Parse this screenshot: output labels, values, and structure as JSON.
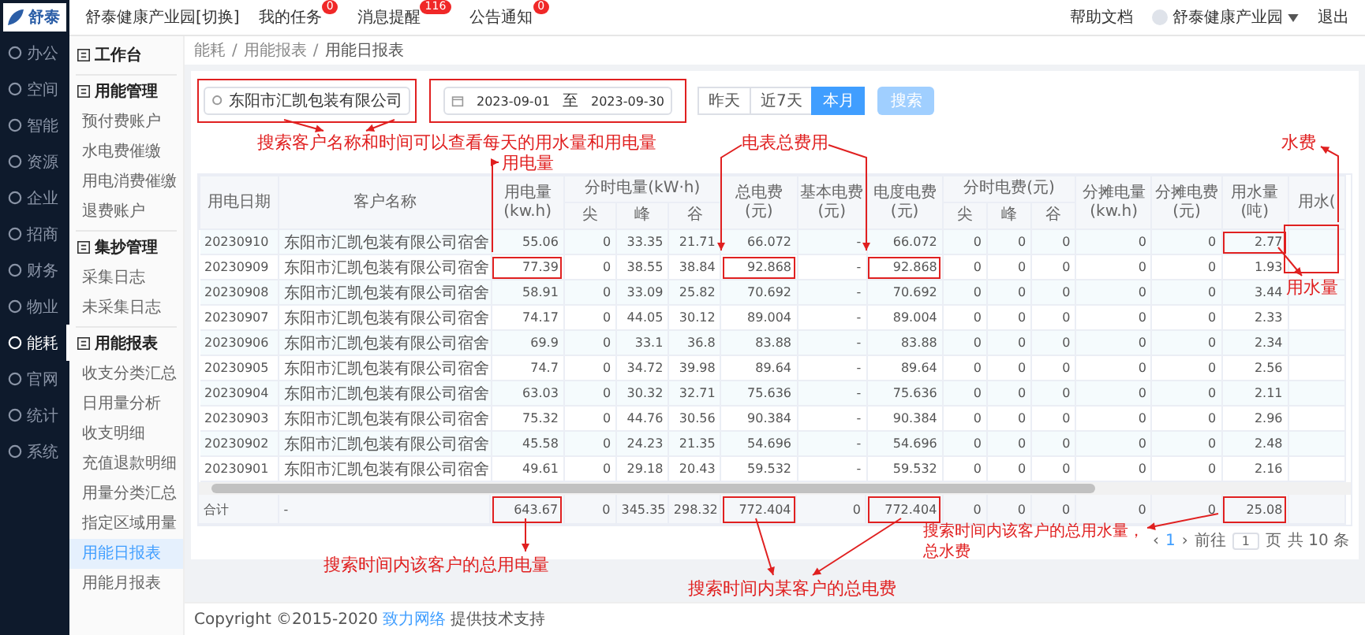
{
  "top_bar": {
    "logo": "舒泰",
    "org": "舒泰健康产业园",
    "switch": "[切换]",
    "links": [
      {
        "label": "我的任务",
        "badge": "0"
      },
      {
        "label": "消息提醒",
        "badge": "116"
      },
      {
        "label": "公告通知",
        "badge": "0"
      }
    ],
    "help": "帮助文档",
    "user": "舒泰健康产业园",
    "logout": "退出"
  },
  "nav": [
    {
      "label": "办公",
      "selected": false
    },
    {
      "label": "空间",
      "selected": false
    },
    {
      "label": "智能",
      "selected": false
    },
    {
      "label": "资源",
      "selected": false
    },
    {
      "label": "企业",
      "selected": false
    },
    {
      "label": "招商",
      "selected": false
    },
    {
      "label": "财务",
      "selected": false
    },
    {
      "label": "物业",
      "selected": false
    },
    {
      "label": "能耗",
      "selected": true
    },
    {
      "label": "官网",
      "selected": false
    },
    {
      "label": "统计",
      "selected": false
    },
    {
      "label": "系统",
      "selected": false
    }
  ],
  "submenu": {
    "workbench": "工作台",
    "groups": [
      {
        "title": "用能管理",
        "items": [
          {
            "label": "预付费账户",
            "selected": false
          },
          {
            "label": "水电费催缴",
            "selected": false
          },
          {
            "label": "用电消费催缴",
            "selected": false
          },
          {
            "label": "退费账户",
            "selected": false
          }
        ]
      },
      {
        "title": "集抄管理",
        "items": [
          {
            "label": "采集日志",
            "selected": false
          },
          {
            "label": "未采集日志",
            "selected": false
          }
        ]
      },
      {
        "title": "用能报表",
        "items": [
          {
            "label": "收支分类汇总",
            "selected": false
          },
          {
            "label": "日用量分析",
            "selected": false
          },
          {
            "label": "收支明细",
            "selected": false
          },
          {
            "label": "充值退款明细",
            "selected": false
          },
          {
            "label": "用量分类汇总",
            "selected": false
          },
          {
            "label": "指定区域用量",
            "selected": false
          },
          {
            "label": "用能日报表",
            "selected": true
          },
          {
            "label": "用能月报表",
            "selected": false
          }
        ]
      }
    ]
  },
  "breadcrumb": [
    "能耗",
    "用能报表",
    "用能日报表"
  ],
  "breadcrumb_separator": "/",
  "filter": {
    "customer": "东阳市汇凯包装有限公司",
    "date_from": "2023-09-01",
    "separator": "至",
    "date_to": "2023-09-30",
    "ranges": [
      {
        "label": "昨天",
        "selected": false
      },
      {
        "label": "近7天",
        "selected": false
      },
      {
        "label": "本月",
        "selected": true
      }
    ],
    "search_button": "搜索"
  },
  "table": {
    "columns": [
      {
        "label": "用电日期"
      },
      {
        "label": "客户名称"
      },
      {
        "label": "用电量(kw.h)"
      },
      {
        "label": "分时电量(kW·h)",
        "colspan": 3,
        "children": [
          {
            "label": "尖"
          },
          {
            "label": "峰"
          },
          {
            "label": "谷"
          }
        ]
      },
      {
        "label": "总电费(元)"
      },
      {
        "label": "基本电费(元)"
      },
      {
        "label": "电度电费(元)"
      },
      {
        "label": "分时电费(元)",
        "colspan": 3,
        "children": [
          {
            "label": "尖"
          },
          {
            "label": "峰"
          },
          {
            "label": "谷"
          }
        ]
      },
      {
        "label": "分摊电量(kw.h)"
      },
      {
        "label": "分摊电费(元)"
      },
      {
        "label": "用水量(吨)"
      }
    ],
    "cut_column_header": "用水(",
    "rows": [
      [
        "20230910",
        "东阳市汇凯包装有限公司宿舍",
        "55.06",
        "0",
        "33.35",
        "21.71",
        "66.072",
        "-",
        "66.072",
        "0",
        "0",
        "0",
        "0",
        "0",
        "2.77"
      ],
      [
        "20230909",
        "东阳市汇凯包装有限公司宿舍",
        "77.39",
        "0",
        "38.55",
        "38.84",
        "92.868",
        "-",
        "92.868",
        "0",
        "0",
        "0",
        "0",
        "0",
        "1.93"
      ],
      [
        "20230908",
        "东阳市汇凯包装有限公司宿舍",
        "58.91",
        "0",
        "33.09",
        "25.82",
        "70.692",
        "-",
        "70.692",
        "0",
        "0",
        "0",
        "0",
        "0",
        "3.44"
      ],
      [
        "20230907",
        "东阳市汇凯包装有限公司宿舍",
        "74.17",
        "0",
        "44.05",
        "30.12",
        "89.004",
        "-",
        "89.004",
        "0",
        "0",
        "0",
        "0",
        "0",
        "2.33"
      ],
      [
        "20230906",
        "东阳市汇凯包装有限公司宿舍",
        "69.9",
        "0",
        "33.1",
        "36.8",
        "83.88",
        "-",
        "83.88",
        "0",
        "0",
        "0",
        "0",
        "0",
        "2.34"
      ],
      [
        "20230905",
        "东阳市汇凯包装有限公司宿舍",
        "74.7",
        "0",
        "34.72",
        "39.98",
        "89.64",
        "-",
        "89.64",
        "0",
        "0",
        "0",
        "0",
        "0",
        "2.56"
      ],
      [
        "20230904",
        "东阳市汇凯包装有限公司宿舍",
        "63.03",
        "0",
        "30.32",
        "32.71",
        "75.636",
        "-",
        "75.636",
        "0",
        "0",
        "0",
        "0",
        "0",
        "2.11"
      ],
      [
        "20230903",
        "东阳市汇凯包装有限公司宿舍",
        "75.32",
        "0",
        "44.76",
        "30.56",
        "90.384",
        "-",
        "90.384",
        "0",
        "0",
        "0",
        "0",
        "0",
        "2.96"
      ],
      [
        "20230902",
        "东阳市汇凯包装有限公司宿舍",
        "45.58",
        "0",
        "24.23",
        "21.35",
        "54.696",
        "-",
        "54.696",
        "0",
        "0",
        "0",
        "0",
        "0",
        "2.48"
      ],
      [
        "20230901",
        "东阳市汇凯包装有限公司宿舍",
        "49.61",
        "0",
        "29.18",
        "20.43",
        "59.532",
        "-",
        "59.532",
        "0",
        "0",
        "0",
        "0",
        "0",
        "2.16"
      ]
    ],
    "total": [
      "合计",
      "-",
      "643.67",
      "0",
      "345.35",
      "298.32",
      "772.404",
      "0",
      "772.404",
      "0",
      "0",
      "0",
      "0",
      "0",
      "25.08"
    ]
  },
  "pagination": {
    "prev": "‹",
    "pages": [
      {
        "label": "1",
        "selected": true
      }
    ],
    "next": "›",
    "goto": "前往",
    "page_input": "1",
    "page_unit": "页",
    "total": "共 10 条"
  },
  "footer": {
    "copyright": "Copyright ©2015-2020",
    "company": "致力网络",
    "suffix": "提供技术支持"
  },
  "annotations": [
    {
      "text": "搜索客户名称和时间可以查看每天的用水量和用电量"
    },
    {
      "text": "电表总费用"
    },
    {
      "text": "水费"
    },
    {
      "text": "用电量"
    },
    {
      "text": "用水量"
    },
    {
      "text": "搜索时间内该客户的总用电量"
    },
    {
      "text": "搜索时间内某客户的总电费"
    },
    {
      "text": "搜索时间内该客户的总用水量，总水费"
    }
  ]
}
